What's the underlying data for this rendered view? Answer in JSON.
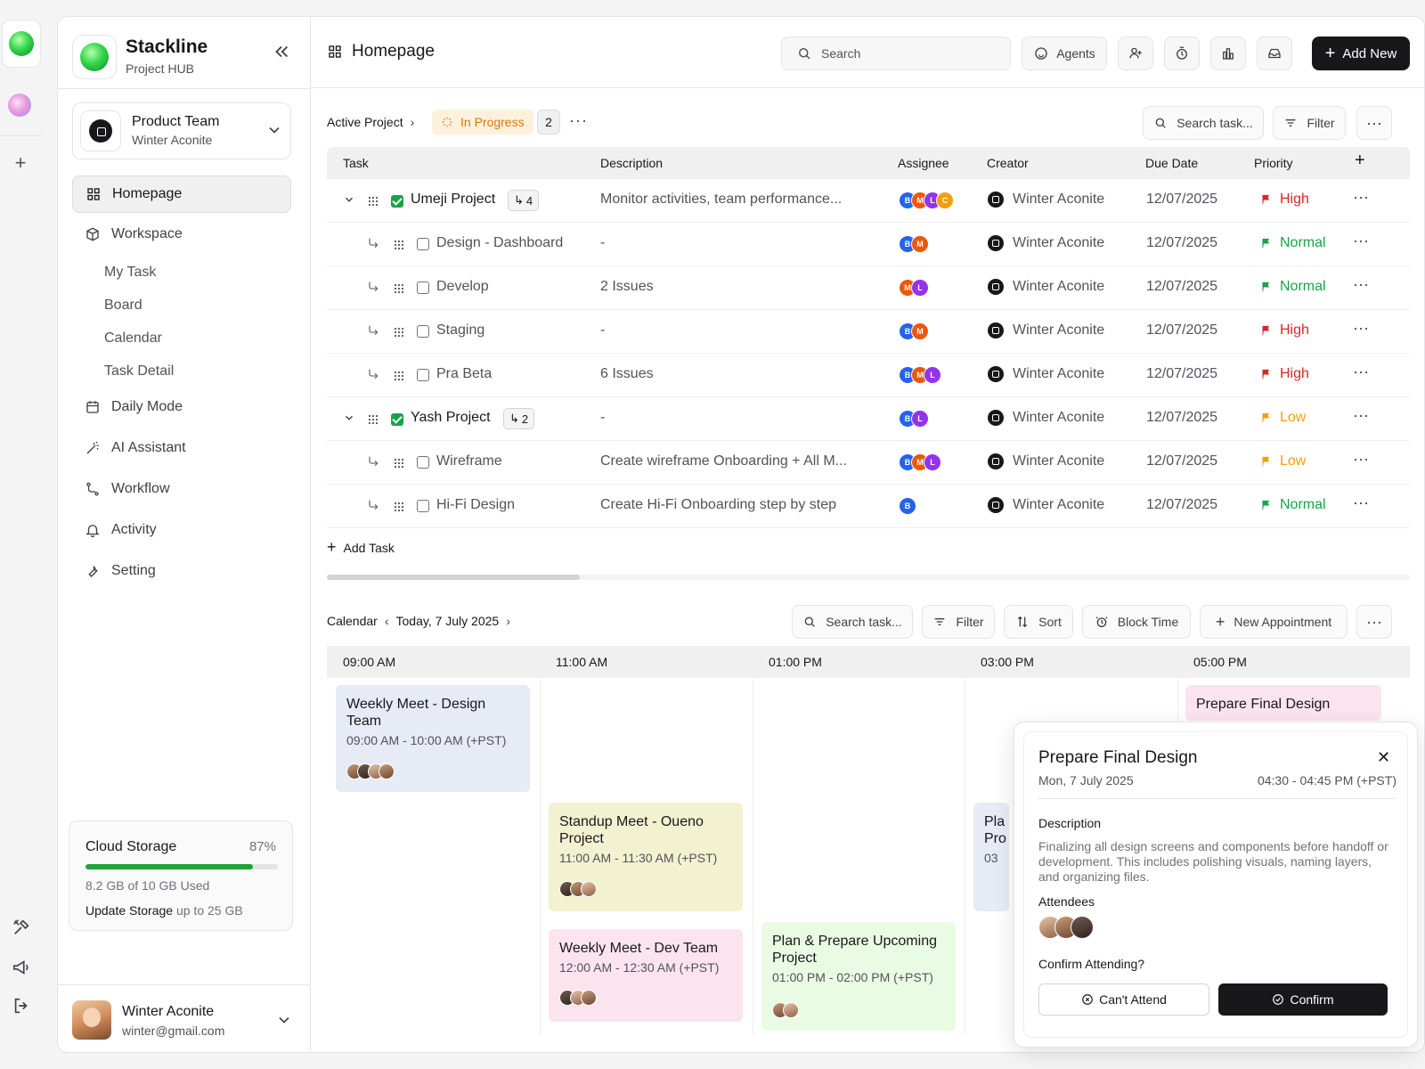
{
  "app": {
    "name": "Stackline",
    "subtitle": "Project HUB"
  },
  "team": {
    "name": "Product Team",
    "owner": "Winter Aconite"
  },
  "nav": {
    "items": [
      {
        "label": "Homepage",
        "icon": "grid-icon"
      },
      {
        "label": "Workspace",
        "icon": "box-icon"
      },
      {
        "label": "Daily Mode",
        "icon": "calendar-icon"
      },
      {
        "label": "AI Assistant",
        "icon": "magic-wand-icon"
      },
      {
        "label": "Workflow",
        "icon": "workflow-icon"
      },
      {
        "label": "Activity",
        "icon": "bell-icon"
      },
      {
        "label": "Setting",
        "icon": "wrench-icon"
      }
    ],
    "workspace_sub": [
      "My Task",
      "Board",
      "Calendar",
      "Task Detail"
    ]
  },
  "storage": {
    "title": "Cloud Storage",
    "percent_label": "87%",
    "percent": 0.87,
    "used": "8.2 GB of 10 GB Used",
    "update_label": "Update Storage",
    "update_note": "up to 25 GB"
  },
  "user": {
    "name": "Winter Aconite",
    "email": "winter@gmail.com"
  },
  "topbar": {
    "title": "Homepage",
    "search_placeholder": "Search",
    "agents_label": "Agents",
    "add_new_label": "Add New"
  },
  "project": {
    "breadcrumb": "Active Project",
    "status": "In Progress",
    "count": "2",
    "search_placeholder": "Search task...",
    "filter_label": "Filter",
    "add_task_label": "Add Task",
    "columns": [
      "Task",
      "Description",
      "Assignee",
      "Creator",
      "Due Date",
      "Priority"
    ],
    "rows": [
      {
        "name": "Umeji Project",
        "parent": true,
        "subcount": "4",
        "description": "Monitor activities, team performance...",
        "assignees": [
          "B",
          "M",
          "L",
          "C"
        ],
        "creator": "Winter Aconite",
        "due": "12/07/2025",
        "priority": "High"
      },
      {
        "name": "Design - Dashboard",
        "parent": false,
        "description": "-",
        "assignees": [
          "B",
          "M"
        ],
        "creator": "Winter Aconite",
        "due": "12/07/2025",
        "priority": "Normal"
      },
      {
        "name": "Develop",
        "parent": false,
        "description": "2 Issues",
        "assignees": [
          "M",
          "L"
        ],
        "creator": "Winter Aconite",
        "due": "12/07/2025",
        "priority": "Normal"
      },
      {
        "name": "Staging",
        "parent": false,
        "description": "-",
        "assignees": [
          "B",
          "M"
        ],
        "creator": "Winter Aconite",
        "due": "12/07/2025",
        "priority": "High"
      },
      {
        "name": "Pra Beta",
        "parent": false,
        "description": "6 Issues",
        "assignees": [
          "B",
          "M",
          "L"
        ],
        "creator": "Winter Aconite",
        "due": "12/07/2025",
        "priority": "High"
      },
      {
        "name": "Yash Project",
        "parent": true,
        "subcount": "2",
        "description": "-",
        "assignees": [
          "B",
          "L"
        ],
        "creator": "Winter Aconite",
        "due": "12/07/2025",
        "priority": "Low"
      },
      {
        "name": "Wireframe",
        "parent": false,
        "description": "Create wireframe Onboarding + All M...",
        "assignees": [
          "B",
          "M",
          "L"
        ],
        "creator": "Winter Aconite",
        "due": "12/07/2025",
        "priority": "Low"
      },
      {
        "name": "Hi-Fi Design",
        "parent": false,
        "description": "Create Hi-Fi Onboarding step by step",
        "assignees": [
          "B"
        ],
        "creator": "Winter Aconite",
        "due": "12/07/2025",
        "priority": "Normal"
      }
    ]
  },
  "priority_colors": {
    "High": "#dc2626",
    "Normal": "#16a34a",
    "Low": "#f59e0b"
  },
  "assignee_colors": {
    "B": "#2563eb",
    "M": "#ea580c",
    "L": "#9333ea",
    "C": "#f59e0b"
  },
  "calendar": {
    "label": "Calendar",
    "date": "Today, 7 July 2025",
    "search_placeholder": "Search task...",
    "filter_label": "Filter",
    "sort_label": "Sort",
    "block_time_label": "Block Time",
    "new_appointment_label": "New Appointment",
    "hours": [
      "09:00 AM",
      "11:00 AM",
      "01:00 PM",
      "03:00 PM",
      "05:00 PM"
    ],
    "events": [
      {
        "title": "Weekly Meet - Design Team",
        "time": "09:00 AM - 10:00 AM (+PST)"
      },
      {
        "title": "Standup Meet - Oueno Project",
        "time": "11:00 AM - 11:30 AM (+PST)"
      },
      {
        "title": "Weekly Meet - Dev Team",
        "time": "12:00 AM - 12:30 AM (+PST)"
      },
      {
        "title": "Plan & Prepare Upcoming Project",
        "time": "01:00 PM - 02:00 PM (+PST)"
      },
      {
        "title": "Pla Pro",
        "time": "03"
      },
      {
        "title": "Prepare Final Design",
        "time": ""
      }
    ],
    "event_colors": [
      "#e6ebf5",
      "#f2f1d0",
      "#fbe4ee",
      "#eafbe3",
      "#e6ebf5",
      "#fbe4ee"
    ]
  },
  "popover": {
    "title": "Prepare Final Design",
    "date": "Mon, 7 July 2025",
    "time": "04:30 - 04:45 PM (+PST)",
    "description_label": "Description",
    "description": "Finalizing all design screens and components before handoff or development. This includes polishing visuals, naming layers, and organizing files.",
    "attendees_label": "Attendees",
    "confirm_question": "Confirm Attending?",
    "cant_attend_label": "Can't Attend",
    "confirm_label": "Confirm"
  }
}
